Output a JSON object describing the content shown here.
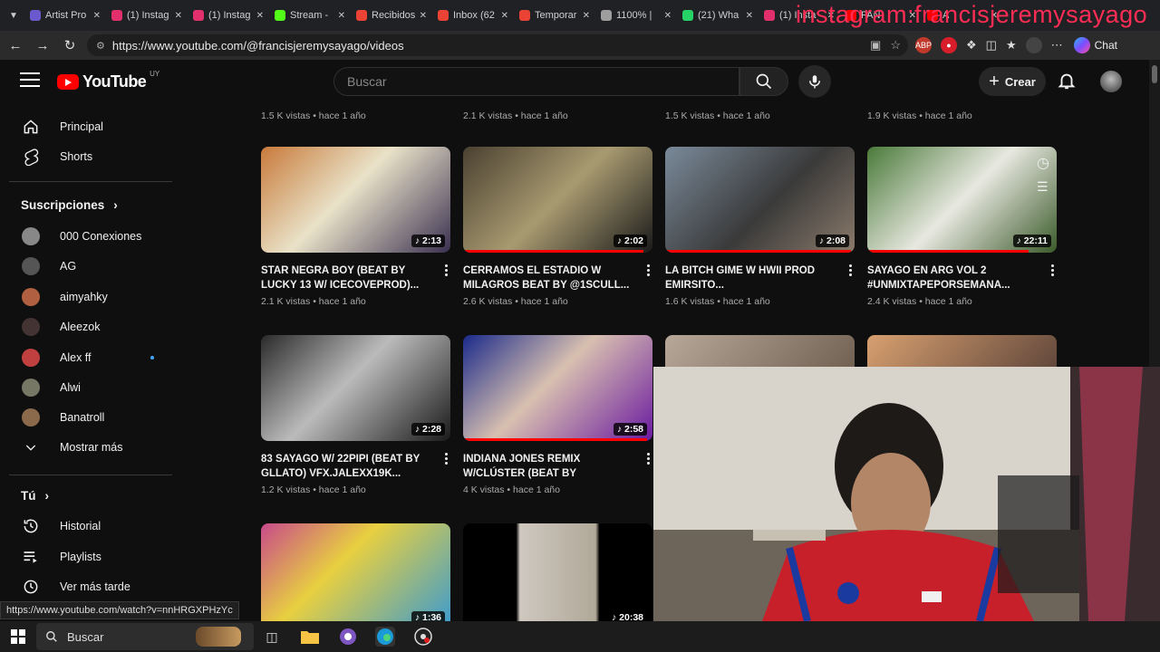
{
  "browser": {
    "tabs": [
      {
        "title": "Artist Pro",
        "color": "#6a5acd"
      },
      {
        "title": "(1) Instag",
        "color": "#e1306c"
      },
      {
        "title": "(1) Instag",
        "color": "#e1306c"
      },
      {
        "title": "Stream -",
        "color": "#53fc18"
      },
      {
        "title": "Recibidos",
        "color": "#ea4335"
      },
      {
        "title": "Inbox (62",
        "color": "#ea4335"
      },
      {
        "title": "Temporar",
        "color": "#ea4335"
      },
      {
        "title": "1100% |",
        "color": "#9e9e9e"
      },
      {
        "title": "(21) Wha",
        "color": "#25d366"
      },
      {
        "title": "(1) Insta",
        "color": "#e1306c"
      },
      {
        "title": "FAN",
        "color": "#ff0000"
      },
      {
        "title": "A",
        "color": "#ff0000"
      }
    ],
    "watermark": "instagram:francisjeremysayago",
    "url": "https://www.youtube.com/@francisjeremysayago/videos",
    "chat_label": "Chat",
    "status_url": "https://www.youtube.com/watch?v=nnHRGXPHzYc"
  },
  "youtube": {
    "logo_text": "YouTube",
    "country_code": "UY",
    "search_placeholder": "Buscar",
    "create_label": "Crear"
  },
  "sidebar": {
    "principal": "Principal",
    "shorts": "Shorts",
    "subs_header": "Suscripciones",
    "subscriptions": [
      {
        "name": "000 Conexiones",
        "color": "#888888"
      },
      {
        "name": "AG",
        "color": "#555555"
      },
      {
        "name": "aimyahky",
        "color": "#b06040"
      },
      {
        "name": "Aleezok",
        "color": "#443333"
      },
      {
        "name": "Alex ff",
        "color": "#c04040"
      },
      {
        "name": "Alwi",
        "color": "#777766"
      },
      {
        "name": "Banatroll",
        "color": "#8a6a4a"
      }
    ],
    "show_more": "Mostrar más",
    "you_header": "Tú",
    "history": "Historial",
    "playlists": "Playlists",
    "watch_later": "Ver más tarde"
  },
  "top_meta": [
    "1.5 K vistas • hace 1 año",
    "2.1 K vistas • hace 1 año",
    "1.5 K vistas • hace 1 año",
    "1.9 K vistas • hace 1 año"
  ],
  "videos": [
    {
      "title": "STAR NEGRA BOY (BEAT BY LUCKY 13 W/ ICECOVEPROD)...",
      "meta": "2.1 K vistas • hace 1 año",
      "duration": "2:13",
      "bg": "linear-gradient(135deg,#c87a3a,#e9e2c8 45%,#3a3050)",
      "progress": 0
    },
    {
      "title": "CERRAMOS EL ESTADIO W MILAGROS BEAT BY @1SCULL...",
      "meta": "2.6 K vistas • hace 1 año",
      "duration": "2:02",
      "bg": "linear-gradient(135deg,#4a4030,#a89a70 50%,#1a1a1a)",
      "progress": 0.95
    },
    {
      "title": "LA BITCH GIME W HWII PROD EMIRSITO...",
      "meta": "1.6 K vistas • hace 1 año",
      "duration": "2:08",
      "bg": "linear-gradient(135deg,#7a8a9a,#3a3a3a 55%,#8a7a6a)",
      "progress": 0.98
    },
    {
      "title": "SAYAGO EN ARG VOL 2 #UNMIXTAPEPORSEMANA...",
      "meta": "2.4 K vistas • hace 1 año",
      "duration": "22:11",
      "bg": "linear-gradient(135deg,#4a7a3a,#e8e8e0 50%,#3a5a2a)",
      "progress": 0.85
    },
    {
      "title": "83 SAYAGO W/ 22PIPI (BEAT BY GLLATO) VFX.JALEXX19K...",
      "meta": "1.2 K vistas • hace 1 año",
      "duration": "2:28",
      "bg": "linear-gradient(135deg,#2a2a2a,#bbbbbb 45%,#1a1a1a)",
      "progress": 0
    },
    {
      "title": "INDIANA JONES REMIX W/CLÚSTER (BEAT BY MATTE?)...",
      "meta": "4 K vistas • hace 1 año",
      "duration": "2:58",
      "bg": "linear-gradient(135deg,#1a2a8a,#d8c0b0 45%,#6a1aa0)",
      "progress": 0.97
    },
    {
      "title": "",
      "meta": "",
      "duration": "1:36",
      "bg": "linear-gradient(135deg,#c84a8a,#e8d040 40%,#3a9ad0)",
      "progress": 0
    },
    {
      "title": "",
      "meta": "",
      "duration": "20:38",
      "bg": "linear-gradient(90deg,#000 28%,#cfc8c0 30%,#b0a898 70%,#000 72%)",
      "progress": 0
    },
    {
      "title": "",
      "meta": "",
      "duration": "",
      "bg": "linear-gradient(135deg,#b8a89a,#5a4a3a)",
      "progress": 0
    },
    {
      "title": "",
      "meta": "",
      "duration": "",
      "bg": "linear-gradient(135deg,#d8a070,#3a2a2a)",
      "progress": 0
    }
  ],
  "taskbar": {
    "search_label": "Buscar"
  }
}
